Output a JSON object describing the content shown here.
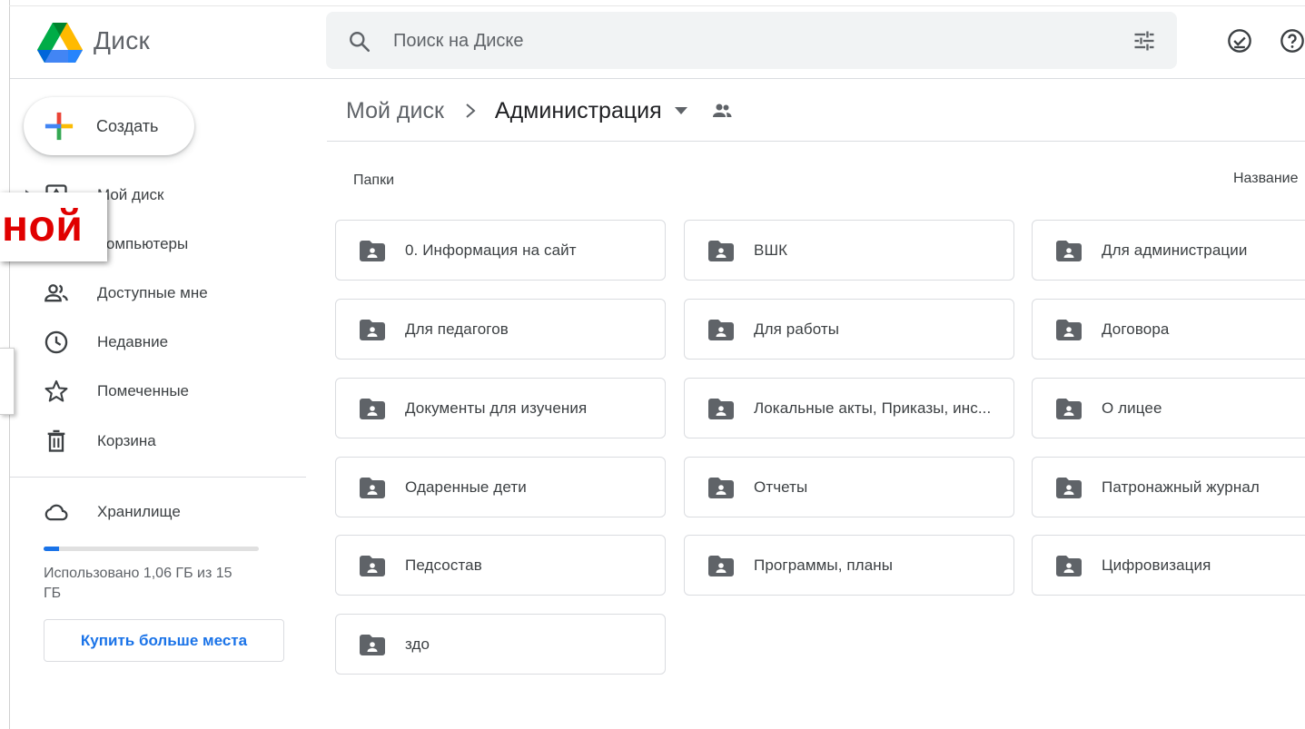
{
  "header": {
    "app_name": "Диск",
    "search_placeholder": "Поиск на Диске",
    "icons": [
      "drive-logo",
      "search-icon",
      "tune-icon",
      "ready-offline-icon",
      "help-icon"
    ]
  },
  "sidebar": {
    "create_label": "Создать",
    "items": [
      {
        "label": "Мой диск",
        "icon": "my-drive-icon"
      },
      {
        "label": "Компьютеры",
        "icon": "computer-icon"
      },
      {
        "label": "Доступные мне",
        "icon": "shared-icon"
      },
      {
        "label": "Недавние",
        "icon": "clock-icon"
      },
      {
        "label": "Помеченные",
        "icon": "star-icon"
      },
      {
        "label": "Корзина",
        "icon": "trash-icon"
      }
    ],
    "storage": {
      "label": "Хранилище",
      "used_text": "Использовано 1,06 ГБ из 15 ГБ",
      "used_fraction": 0.07,
      "buy_label": "Купить больше места"
    }
  },
  "overlay": {
    "text": "ной",
    "color": "#e00000"
  },
  "breadcrumb": {
    "root": "Мой диск",
    "current": "Администрация"
  },
  "main": {
    "section_label": "Папки",
    "sort_label": "Название",
    "folders": [
      "0. Информация на сайт",
      "ВШК",
      "Для администрации",
      "Для педагогов",
      "Для работы",
      "Договора",
      "Документы для изучения",
      "Локальные акты, Приказы, инс...",
      "О лицее",
      "Одаренные дети",
      "Отчеты",
      "Патронажный журнал",
      "Педсостав",
      "Программы, планы",
      "Цифровизация",
      "здо"
    ]
  },
  "colors": {
    "accent": "#1a73e8",
    "icon_grey": "#5f6368",
    "text": "#3c4043"
  }
}
